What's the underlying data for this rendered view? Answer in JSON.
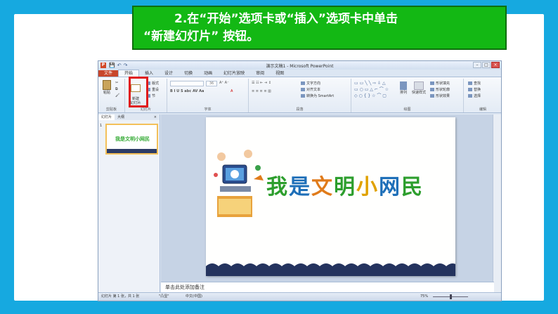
{
  "caption": {
    "line1": "2.在“开始”选项卡或“插入”选项卡中单击",
    "line2": "“新建幻灯片” 按钮。"
  },
  "window": {
    "title": "演示文稿1 - Microsoft PowerPoint",
    "qat": [
      "💾",
      "↶",
      "↷"
    ],
    "controls": [
      "–",
      "□",
      "×"
    ]
  },
  "tabs": [
    "文件",
    "开始",
    "插入",
    "设计",
    "切换",
    "动画",
    "幻灯片放映",
    "审阅",
    "视图"
  ],
  "ribbon": {
    "clipboard": {
      "paste": "粘贴",
      "label": "剪贴板"
    },
    "slides": {
      "new_slide": "新建\n幻灯片",
      "layout": "版式",
      "reset": "重设",
      "section": "节",
      "label": "幻灯片"
    },
    "font": {
      "label": "字体",
      "size": "36"
    },
    "paragraph": {
      "label": "段落",
      "text_dir": "文字方向",
      "align_text": "对齐文本",
      "smartart": "转换为 SmartArt"
    },
    "drawing": {
      "label": "绘图",
      "arrange": "排列",
      "quick_styles": "快速样式",
      "fill": "形状填充",
      "outline": "形状轮廓",
      "effects": "形状效果"
    },
    "editing": {
      "label": "编辑",
      "find": "查找",
      "replace": "替换",
      "select": "选择"
    }
  },
  "panel": {
    "tab_slides": "幻灯片",
    "tab_outline": "大纲",
    "close": "×",
    "thumb_num": "1",
    "thumb_title": "我是文明小网民"
  },
  "slide": {
    "title_chars": [
      "我",
      "是",
      "文",
      "明",
      "小",
      "网",
      "民"
    ]
  },
  "notes": {
    "placeholder": "单击此处添加备注"
  },
  "status": {
    "slide_info": "幻灯片 第 1 张，共 1 张",
    "theme": "\"凸显\"",
    "lang": "中文(中国)",
    "zoom": "75%",
    "zoom_fraction": 0.5
  }
}
